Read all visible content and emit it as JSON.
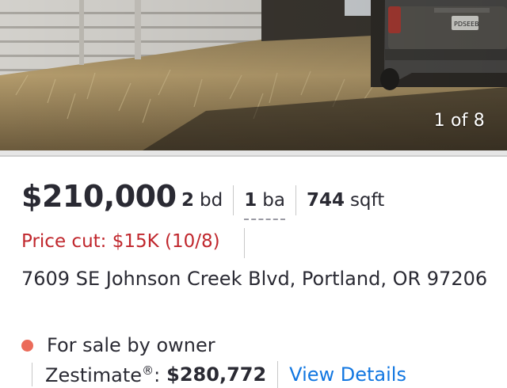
{
  "photo": {
    "counter": "1 of 8",
    "plate": "PDSEEB"
  },
  "listing": {
    "price": "$210,000",
    "beds_value": "2",
    "beds_unit": "bd",
    "baths_value": "1",
    "baths_unit": "ba",
    "sqft_value": "744",
    "sqft_unit": "sqft",
    "price_cut": "Price cut: $15K (10/8)",
    "address": "7609 SE Johnson Creek Blvd, Portland, OR 97206",
    "status": "For sale by owner",
    "zestimate_label": "Zestimate",
    "zestimate_mark": "®",
    "zestimate_colon": ":",
    "zestimate_value": "$280,772",
    "view_details": "View Details"
  },
  "colors": {
    "price_cut": "#c0272d",
    "status_dot": "#eb6b5a",
    "link": "#1277e1",
    "text": "#2a2a33"
  }
}
